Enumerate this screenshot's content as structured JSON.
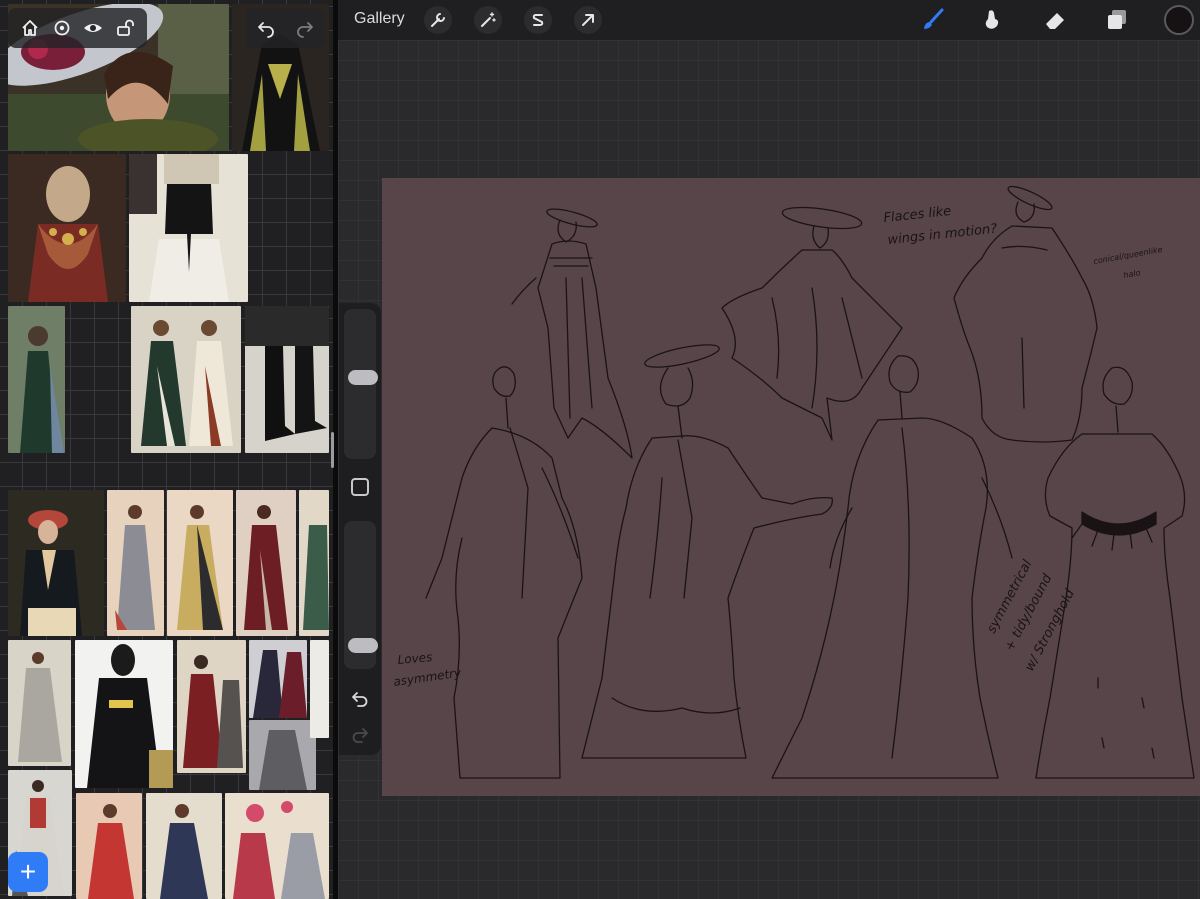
{
  "top_bar": {
    "gallery_label": "Gallery",
    "left_tools": [
      "wrench-icon",
      "magic-wand-icon",
      "selection-s-icon",
      "transform-arrow-icon"
    ],
    "right_tools": [
      "brush-icon",
      "smudge-icon",
      "eraser-icon",
      "layers-icon"
    ],
    "active_tool": "brush-icon",
    "accent_color": "#2f7cf6",
    "current_color": "#161213"
  },
  "reference_panel": {
    "toolbar_icons": [
      "home-icon",
      "settings-icon",
      "eye-icon",
      "unlock-icon"
    ],
    "history_icons": [
      "undo-icon",
      "redo-icon"
    ],
    "add_label": "+"
  },
  "side_bar": {
    "size_level": 0.55,
    "opacity_level": 0.1
  },
  "canvas": {
    "background": "#584549",
    "notes": [
      "Flaces like",
      "wings in motion?",
      "conical/queenlike",
      "halo",
      "Loves",
      "asymmetry",
      "symmetrical",
      "+ tidy/bound",
      "w/ Stronghold"
    ]
  }
}
